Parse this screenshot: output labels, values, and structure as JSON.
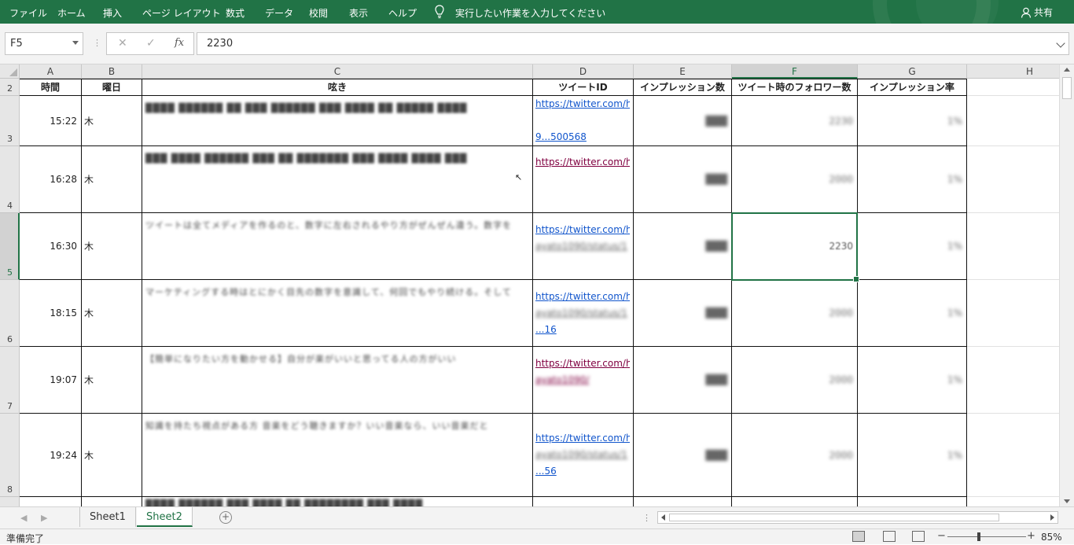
{
  "ribbon": {
    "tabs": [
      "ファイル",
      "ホーム",
      "挿入",
      "ページ レイアウト",
      "数式",
      "データ",
      "校閲",
      "表示",
      "ヘルプ"
    ],
    "tell_me": "実行したい作業を入力してください",
    "share": "共有"
  },
  "formula_bar": {
    "name_box": "F5",
    "formula": "2230",
    "fx": "fx"
  },
  "columns": [
    "A",
    "B",
    "C",
    "D",
    "E",
    "F",
    "G",
    "H"
  ],
  "selected_column": "F",
  "header_row": {
    "row_number": "2",
    "cells": [
      "時間",
      "曜日",
      "呟き",
      "ツイートID",
      "インプレッション数",
      "ツイート時のフォロワー数",
      "インプレッション率"
    ]
  },
  "rows": [
    {
      "row_number": "3",
      "time": "15:22",
      "day": "木",
      "link_lines": [
        "https://twitter.com/h",
        "",
        "9...500568"
      ],
      "tweet": "████ ██████ ██ ███ ██████ ███ ████ ██ █████ ████",
      "impressions": "███",
      "followers": "2230",
      "rate": "1%",
      "visited": false
    },
    {
      "row_number": "4",
      "time": "16:28",
      "day": "木",
      "link_lines": [
        "https://twitter.com/h",
        "",
        ""
      ],
      "tweet": "███ ████ ██████ ███ ██ ███████ ███ ████ ████ ███",
      "impressions": "███",
      "followers": "2000",
      "rate": "1%",
      "visited": true
    },
    {
      "row_number": "5",
      "time": "16:30",
      "day": "木",
      "link_lines": [
        "https://twitter.com/h",
        "ayato1090/status/1",
        ""
      ],
      "tweet": "ツイートは全てメディアを作るのと、数字に左右されるやり方がぜんぜん違う。数字を",
      "impressions": "███",
      "followers": "2230",
      "rate": "1%",
      "visited": false
    },
    {
      "row_number": "6",
      "time": "18:15",
      "day": "木",
      "link_lines": [
        "https://twitter.com/h",
        "ayato1090/status/1",
        "...16"
      ],
      "tweet": "マーケティングする時はとにかく目先の数字を意識して、何回でもやり続ける。そして",
      "impressions": "███",
      "followers": "2000",
      "rate": "1%",
      "visited": false
    },
    {
      "row_number": "7",
      "time": "19:07",
      "day": "木",
      "link_lines": [
        "https://twitter.com/h",
        "ayato1090/",
        ""
      ],
      "tweet": "【簡単になりたい方を動かせる】自分が楽がいいと思ってる人の方がいい",
      "impressions": "███",
      "followers": "2000",
      "rate": "1%",
      "visited": true
    },
    {
      "row_number": "8",
      "time": "19:24",
      "day": "木",
      "link_lines": [
        "https://twitter.com/h",
        "ayato1090/status/1",
        "...56"
      ],
      "tweet": "知識を持たち視点がある方 音楽をどう聴きますか？いい音楽なら、いい音楽だと",
      "impressions": "███",
      "followers": "2000",
      "rate": "1%",
      "visited": false
    }
  ],
  "sheets": {
    "tabs": [
      "Sheet1",
      "Sheet2"
    ],
    "active": "Sheet2"
  },
  "status": {
    "ready": "準備完了",
    "zoom": "85%"
  },
  "colors": {
    "excel_green": "#217346",
    "link": "#1155cc",
    "visited_link": "#800040"
  }
}
